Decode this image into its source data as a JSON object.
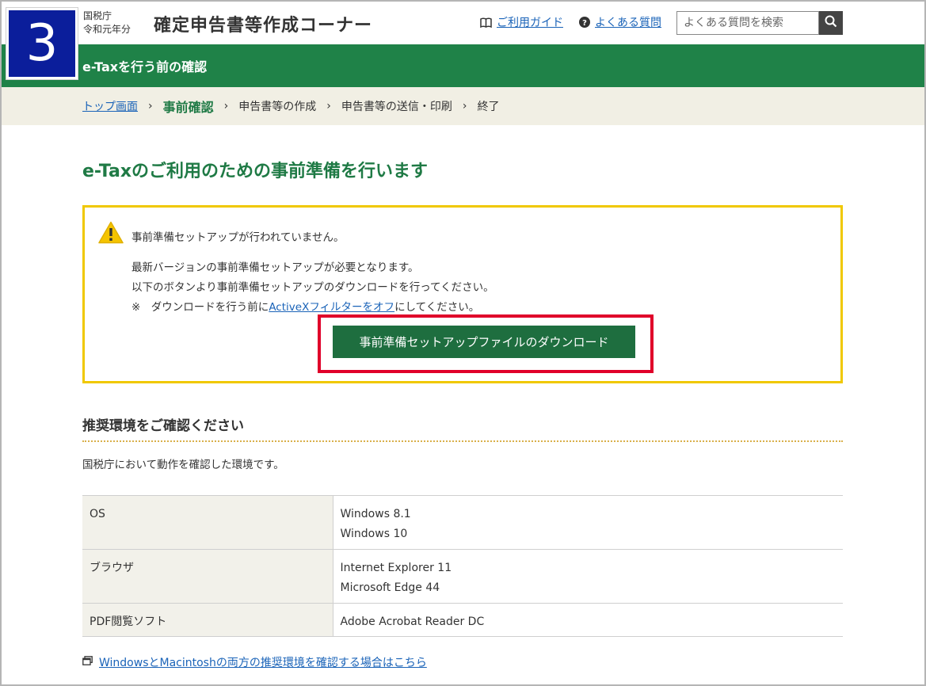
{
  "header": {
    "step_number": "3",
    "agency_line1": "国税庁",
    "agency_line2": "令和元年分",
    "site_title": "確定申告書等作成コーナー",
    "guide_link": "ご利用ガイド",
    "faq_link": "よくある質問",
    "search_placeholder": "よくある質問を検索"
  },
  "greenbar": {
    "label": "e-Taxを行う前の確認"
  },
  "breadcrumb": {
    "items": [
      "トップ画面",
      "事前確認",
      "申告書等の作成",
      "申告書等の送信・印刷",
      "終了"
    ],
    "separator": "›"
  },
  "main": {
    "heading": "e-Taxのご利用のための事前準備を行います",
    "notice": {
      "warning": "事前準備セットアップが行われていません。",
      "line2": "最新バージョンの事前準備セットアップが必要となります。",
      "line3": "以下のボタンより事前準備セットアップのダウンロードを行ってください。",
      "line4_prefix": "※　ダウンロードを行う前に",
      "line4_link": "ActiveXフィルターをオフ",
      "line4_suffix": "にしてください。",
      "download_button": "事前準備セットアップファイルのダウンロード"
    },
    "env_heading": "推奨環境をご確認ください",
    "env_desc": "国税庁において動作を確認した環境です。",
    "env_table": [
      {
        "key": "OS",
        "values": [
          "Windows 8.1",
          "Windows 10"
        ]
      },
      {
        "key": "ブラウザ",
        "values": [
          "Internet Explorer 11",
          "Microsoft Edge 44"
        ]
      },
      {
        "key": "PDF閲覧ソフト",
        "values": [
          "Adobe Acrobat Reader DC"
        ]
      }
    ],
    "bottom_link": "WindowsとMacintoshの両方の推奨環境を確認する場合はこちら"
  },
  "colors": {
    "step_box": "#0b1e9b",
    "green_bar": "#1f8248",
    "heading_green": "#1f7a45",
    "notice_border": "#f0c800",
    "highlight_red": "#e0002a",
    "button_green": "#1e6e3f",
    "link_blue": "#1a63b8"
  },
  "icons": {
    "guide": "book-icon",
    "faq": "question-circle-icon",
    "search": "search-icon",
    "warning": "warning-triangle-icon",
    "external": "window-icon"
  }
}
